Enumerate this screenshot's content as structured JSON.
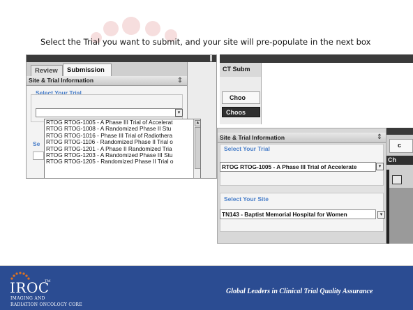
{
  "instruction": "Select the Trial you want to submit, and your site will pre-populate in the  next box",
  "screen1": {
    "tabs": [
      "Review",
      "Submission"
    ],
    "panel_title": "Site & Trial Information",
    "section_label": "Select Your Trial",
    "side_label_fragment": "Se",
    "trial_options": [
      "RTOG RTOG-1005 - A Phase III Trial of Accelerat",
      "RTOG RTOG-1008 - A Randomized Phase II Stu",
      "RTOG RTOG-1016 - Phase III Trial of Radiothera",
      "RTOG RTOG-1106 - Randomized Phase II Trial o",
      "RTOG RTOG-1201 - A Phase II Randomized Tria",
      "RTOG RTOG-1203 - A Randomized Phase III Stu",
      "RTOG RTOG-1205 - Randomized Phase II Trial o"
    ]
  },
  "screen2": {
    "header": "CT Subm",
    "tab_label": "Choo",
    "button_label": "Choos"
  },
  "screen3": {
    "panel_title": "Site & Trial Information",
    "trial_label": "Select Your Trial",
    "trial_value": "RTOG RTOG-1005 - A Phase III Trial of Accelerate",
    "site_label": "Select Your Site",
    "site_value": "TN143 - Baptist Memorial Hospital for Women"
  },
  "screen4": {
    "tab_fragment": "c",
    "button_fragment": "Ch"
  },
  "footer": {
    "logo_main": "IROC",
    "logo_tm": "TM",
    "logo_line1": "IMAGING AND",
    "logo_line2": "RADIATION ONCOLOGY CORE",
    "tagline": "Global Leaders in Clinical Trial Quality Assurance"
  },
  "colors": {
    "footer_bg": "#2b4c92",
    "section_label": "#4a7fc9",
    "logo_accent": "#e2731e"
  }
}
